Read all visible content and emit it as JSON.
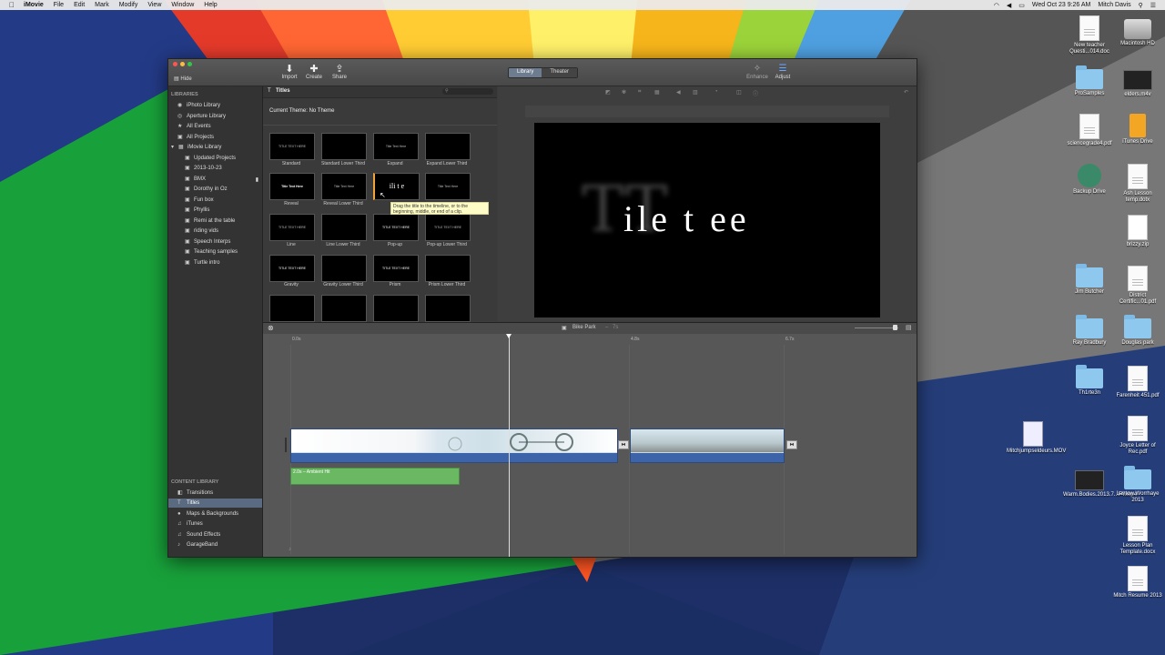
{
  "menubar": {
    "app": "iMovie",
    "items": [
      "File",
      "Edit",
      "Mark",
      "Modify",
      "View",
      "Window",
      "Help"
    ],
    "clock": "Wed Oct 23  9:26 AM",
    "user": "Mitch Davis"
  },
  "desktop": {
    "icons": [
      {
        "label": "New teacher Questi...014.doc",
        "type": "doc"
      },
      {
        "label": "Macintosh HD",
        "type": "drive"
      },
      {
        "label": "ProSamples",
        "type": "folder"
      },
      {
        "label": "elders.m4v",
        "type": "video"
      },
      {
        "label": "sciencegrade4.pdf",
        "type": "doc"
      },
      {
        "label": "iTunes Drive",
        "type": "usb"
      },
      {
        "label": "Backup Drive",
        "type": "time"
      },
      {
        "label": "Ash Lesson temp.dotx",
        "type": "doc"
      },
      {
        "label": "brizzy.zip",
        "type": "zip"
      },
      {
        "label": "Jim Butcher",
        "type": "folder"
      },
      {
        "label": "District Certific...01.pdf",
        "type": "doc"
      },
      {
        "label": "Ray Bradbury",
        "type": "folder"
      },
      {
        "label": "Douglas park",
        "type": "folder"
      },
      {
        "label": "Th1rte3n",
        "type": "folder"
      },
      {
        "label": "Farenheit 451.pdf",
        "type": "doc"
      },
      {
        "label": "Mitchjumpseldeurs.MOV",
        "type": "quick"
      },
      {
        "label": "Joyce Letter of Rec.pdf",
        "type": "doc"
      },
      {
        "label": "Warm.Bodies.2013.7...FY.mp4",
        "type": "video"
      },
      {
        "label": "Lantow Worrhaye 2013",
        "type": "folder"
      },
      {
        "label": "Lesson Plan Template.docx",
        "type": "doc"
      },
      {
        "label": "Mitch Resume 2013",
        "type": "doc"
      }
    ]
  },
  "toolbar": {
    "hide": "Hide",
    "import": "Import",
    "create": "Create",
    "share": "Share",
    "library_tab": "Library",
    "theater_tab": "Theater",
    "enhance": "Enhance",
    "adjust": "Adjust"
  },
  "sidebar": {
    "libraries_header": "LIBRARIES",
    "libraries": [
      {
        "label": "iPhoto Library",
        "icon": "camera-icon"
      },
      {
        "label": "Aperture Library",
        "icon": "aperture-icon"
      },
      {
        "label": "All Events",
        "icon": "star-icon"
      },
      {
        "label": "All Projects",
        "icon": "film-icon"
      },
      {
        "label": "iMovie Library",
        "icon": "star-icon"
      },
      {
        "label": "Updated Projects",
        "icon": "film-icon"
      },
      {
        "label": "2013-10-23",
        "icon": "film-icon"
      },
      {
        "label": "BMX",
        "icon": "film-icon"
      },
      {
        "label": "Dorothy in Oz",
        "icon": "film-icon"
      },
      {
        "label": "Fun box",
        "icon": "film-icon"
      },
      {
        "label": "Phyllis",
        "icon": "film-icon"
      },
      {
        "label": "Remi at the table",
        "icon": "film-icon"
      },
      {
        "label": "riding vids",
        "icon": "film-icon"
      },
      {
        "label": "Speech Interps",
        "icon": "film-icon"
      },
      {
        "label": "Teaching samples",
        "icon": "film-icon"
      },
      {
        "label": "Turtle intro",
        "icon": "film-icon"
      }
    ],
    "content_header": "CONTENT LIBRARY",
    "content": [
      {
        "label": "Transitions",
        "icon": "transitions-icon"
      },
      {
        "label": "Titles",
        "icon": "titles-icon"
      },
      {
        "label": "Maps & Backgrounds",
        "icon": "globe-icon"
      },
      {
        "label": "iTunes",
        "icon": "music-icon"
      },
      {
        "label": "Sound Effects",
        "icon": "music-icon"
      },
      {
        "label": "GarageBand",
        "icon": "guitar-icon"
      }
    ]
  },
  "browser": {
    "header": "Titles",
    "current_theme": "Current Theme: No Theme",
    "titles": [
      {
        "label": "Standard",
        "thumb": "TITLE TEXT HERE"
      },
      {
        "label": "Standard Lower Third",
        "thumb": ""
      },
      {
        "label": "Expand",
        "thumb": "Title Text Here"
      },
      {
        "label": "Expand Lower Third",
        "thumb": ""
      },
      {
        "label": "Reveal",
        "thumb": "Title Text Here"
      },
      {
        "label": "Reveal Lower Third",
        "thumb": "Title Text Here"
      },
      {
        "label": "",
        "thumb": "ili t e"
      },
      {
        "label": "",
        "thumb": "Title Text Here"
      },
      {
        "label": "Line",
        "thumb": "TITLE TEXT HERE"
      },
      {
        "label": "Line Lower Third",
        "thumb": ""
      },
      {
        "label": "Pop-up",
        "thumb": "TITLE TEXT HERE"
      },
      {
        "label": "Pop-up Lower Third",
        "thumb": "TITLE TEXT HERE"
      },
      {
        "label": "Gravity",
        "thumb": "TITLE TEXT HERE"
      },
      {
        "label": "Gravity Lower Third",
        "thumb": ""
      },
      {
        "label": "Prism",
        "thumb": "TITLE TEXT HERE"
      },
      {
        "label": "Prism Lower Third",
        "thumb": ""
      }
    ],
    "tooltip": "Drag the title to the timeline, or to the beginning, middle, or end of a clip."
  },
  "viewer": {
    "ghost_text": "TT",
    "title_text": "ile  t ee"
  },
  "timeline": {
    "project_name": "Bike Park",
    "project_duration": "7s",
    "ticks": [
      "0.0s",
      "4.8s",
      "6.7s"
    ],
    "bg_music_label": "2.0s – Ambient Hit"
  }
}
